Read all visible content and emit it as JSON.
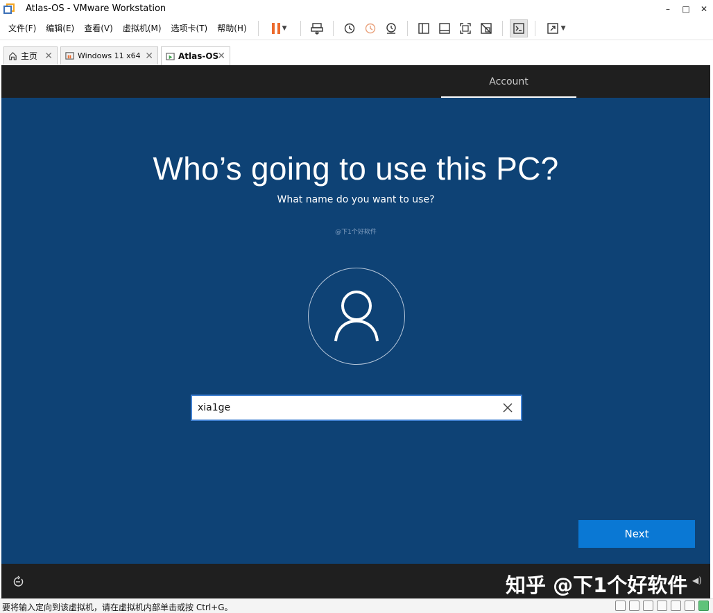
{
  "window": {
    "title": "Atlas-OS - VMware Workstation",
    "controls": {
      "minimize": "–",
      "maximize": "□",
      "close": "✕"
    }
  },
  "menu": {
    "items": [
      "文件(F)",
      "编辑(E)",
      "查看(V)",
      "虚拟机(M)",
      "选项卡(T)",
      "帮助(H)"
    ]
  },
  "tabs": [
    {
      "label": "主页",
      "icon": "home-icon",
      "active": false
    },
    {
      "label": "Windows 11 x64",
      "icon": "vm-icon",
      "active": false
    },
    {
      "label": "Atlas-OS",
      "icon": "vm-running-icon",
      "active": true
    }
  ],
  "tab_close_glyph": "✕",
  "oobe": {
    "header_tab": "Account",
    "heading": "Who’s going to use this PC?",
    "subheading": "What name do you want to use?",
    "watermark_small": "@下1个好软件",
    "name_input": {
      "value": "xia1ge"
    },
    "next_label": "Next",
    "footer_watermark": "知乎 @下1个好软件"
  },
  "statusbar": {
    "text": "要将输入定向到该虚拟机，请在虚拟机内部单击或按 Ctrl+G。"
  },
  "colors": {
    "oobe_background": "#0e4275",
    "oobe_bar": "#1f1f1f",
    "next_button": "#0a78d4",
    "pause_accent": "#ec6a2c"
  }
}
